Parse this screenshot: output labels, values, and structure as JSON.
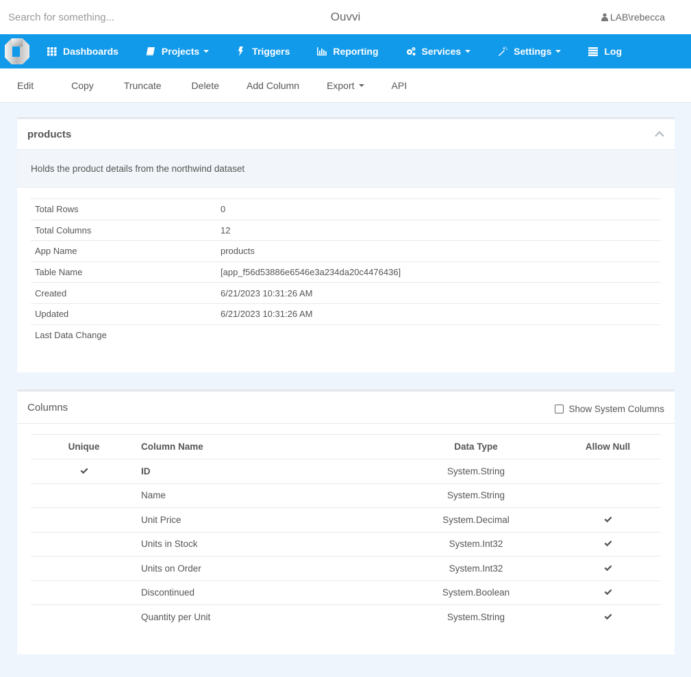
{
  "header": {
    "search_placeholder": "Search for something...",
    "app_title": "Ouvvi",
    "user": "LAB\\rebecca"
  },
  "nav": {
    "items": [
      {
        "label": "Dashboards",
        "icon": "grid-icon",
        "dropdown": false
      },
      {
        "label": "Projects",
        "icon": "book-icon",
        "dropdown": true
      },
      {
        "label": "Triggers",
        "icon": "bolt-icon",
        "dropdown": false
      },
      {
        "label": "Reporting",
        "icon": "bar-chart-icon",
        "dropdown": false
      },
      {
        "label": "Services",
        "icon": "cogs-icon",
        "dropdown": true
      },
      {
        "label": "Settings",
        "icon": "magic-wand-icon",
        "dropdown": true
      },
      {
        "label": "Log",
        "icon": "list-icon",
        "dropdown": false
      }
    ]
  },
  "toolbar": {
    "edit": "Edit",
    "copy": "Copy",
    "truncate": "Truncate",
    "delete": "Delete",
    "add_column": "Add Column",
    "export": "Export",
    "api": "API"
  },
  "details": {
    "title": "products",
    "description": "Holds the product details from the northwind dataset",
    "rows": [
      {
        "label": "Total Rows",
        "value": "0"
      },
      {
        "label": "Total Columns",
        "value": "12"
      },
      {
        "label": "App Name",
        "value": "products"
      },
      {
        "label": "Table Name",
        "value": "[app_f56d53886e6546e3a234da20c4476436]"
      },
      {
        "label": "Created",
        "value": "6/21/2023 10:31:26 AM"
      },
      {
        "label": "Updated",
        "value": "6/21/2023 10:31:26 AM"
      },
      {
        "label": "Last Data Change",
        "value": ""
      }
    ]
  },
  "columns": {
    "title": "Columns",
    "show_system_label": "Show System Columns",
    "show_system_checked": false,
    "headers": {
      "unique": "Unique",
      "name": "Column Name",
      "type": "Data Type",
      "null": "Allow Null"
    },
    "rows": [
      {
        "unique": true,
        "name": "ID",
        "type": "System.String",
        "allow_null": false
      },
      {
        "unique": false,
        "name": "Name",
        "type": "System.String",
        "allow_null": false
      },
      {
        "unique": false,
        "name": "Unit Price",
        "type": "System.Decimal",
        "allow_null": true
      },
      {
        "unique": false,
        "name": "Units in Stock",
        "type": "System.Int32",
        "allow_null": true
      },
      {
        "unique": false,
        "name": "Units on Order",
        "type": "System.Int32",
        "allow_null": true
      },
      {
        "unique": false,
        "name": "Discontinued",
        "type": "System.Boolean",
        "allow_null": true
      },
      {
        "unique": false,
        "name": "Quantity per Unit",
        "type": "System.String",
        "allow_null": true
      }
    ]
  },
  "colors": {
    "nav_bg": "#1199ea",
    "page_bg": "#eef5fd",
    "panel_desc_bg": "#f2f5f9"
  }
}
